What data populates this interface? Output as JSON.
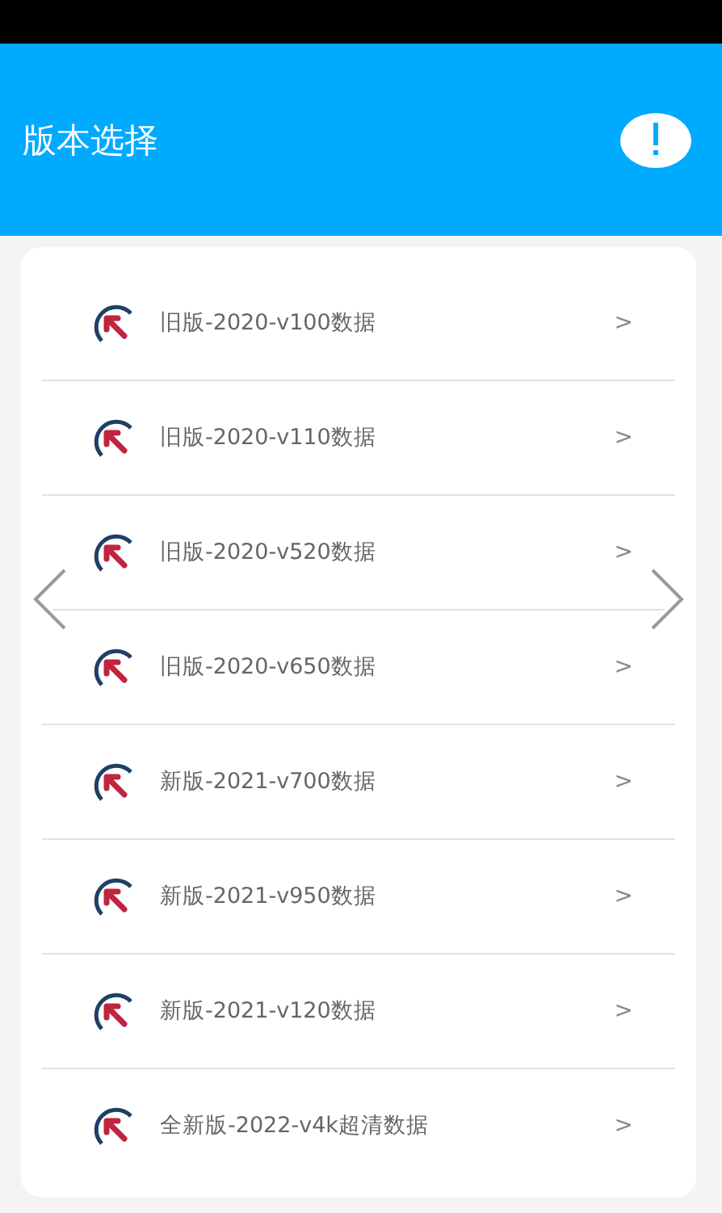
{
  "header": {
    "title": "版本选择"
  },
  "versions": [
    {
      "label": "旧版-2020-v100数据",
      "chevron": ">"
    },
    {
      "label": "旧版-2020-v110数据",
      "chevron": ">"
    },
    {
      "label": "旧版-2020-v520数据",
      "chevron": ">"
    },
    {
      "label": "旧版-2020-v650数据",
      "chevron": ">"
    },
    {
      "label": "新版-2021-v700数据",
      "chevron": ">"
    },
    {
      "label": "新版-2021-v950数据",
      "chevron": ">"
    },
    {
      "label": "新版-2021-v120数据",
      "chevron": ">"
    },
    {
      "label": "全新版-2022-v4k超清数据",
      "chevron": ">"
    }
  ]
}
